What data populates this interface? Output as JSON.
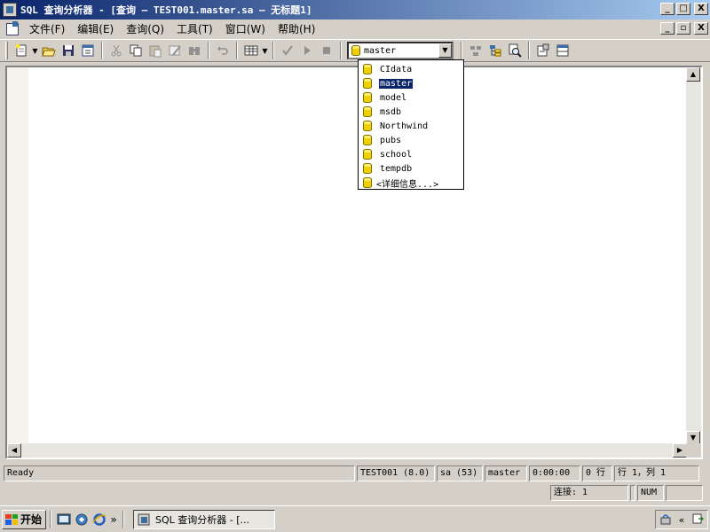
{
  "window": {
    "title": "SQL 查询分析器 - [查询 — TEST001.master.sa — 无标题1]",
    "controls": {
      "minimize": "_",
      "maximize": "□",
      "close": "X"
    },
    "mdi_controls": {
      "minimize": "_",
      "restore": "▫",
      "close": "X"
    }
  },
  "menu": {
    "items": [
      "文件(F)",
      "编辑(E)",
      "查询(Q)",
      "工具(T)",
      "窗口(W)",
      "帮助(H)"
    ]
  },
  "toolbar": {
    "icons": [
      "new-query-icon",
      "open-icon",
      "save-icon",
      "insert-template-icon",
      "cut-icon",
      "copy-icon",
      "paste-icon",
      "clear-window-icon",
      "find-icon",
      "undo-icon",
      "results-grid-icon",
      "parse-query-icon",
      "execute-icon",
      "cancel-execution-icon",
      "estimated-plan-icon",
      "object-browser-icon",
      "object-search-icon",
      "current-connection-icon",
      "show-results-pane-icon"
    ],
    "database_selected": "master"
  },
  "database_list": {
    "items": [
      "CIdata",
      "master",
      "model",
      "msdb",
      "Northwind",
      "pubs",
      "school",
      "tempdb",
      "<详细信息...>"
    ],
    "selected_index": 1
  },
  "statusbar": {
    "ready": "Ready",
    "server": "TEST001 (8.0)",
    "user": "sa (53)",
    "database": "master",
    "elapsed": "0:00:00",
    "rows": "0 行",
    "position": "行 1，列 1",
    "connections": "连接: 1",
    "num": "NUM"
  },
  "taskbar": {
    "start_label": "开始",
    "task_label": "SQL 查询分析器 - [...",
    "chevron": "»",
    "tray_chevron": "«"
  },
  "colors": {
    "title_start": "#0a246a",
    "title_end": "#a6caf0",
    "selection": "#0a246a",
    "face": "#d4d0c8"
  }
}
